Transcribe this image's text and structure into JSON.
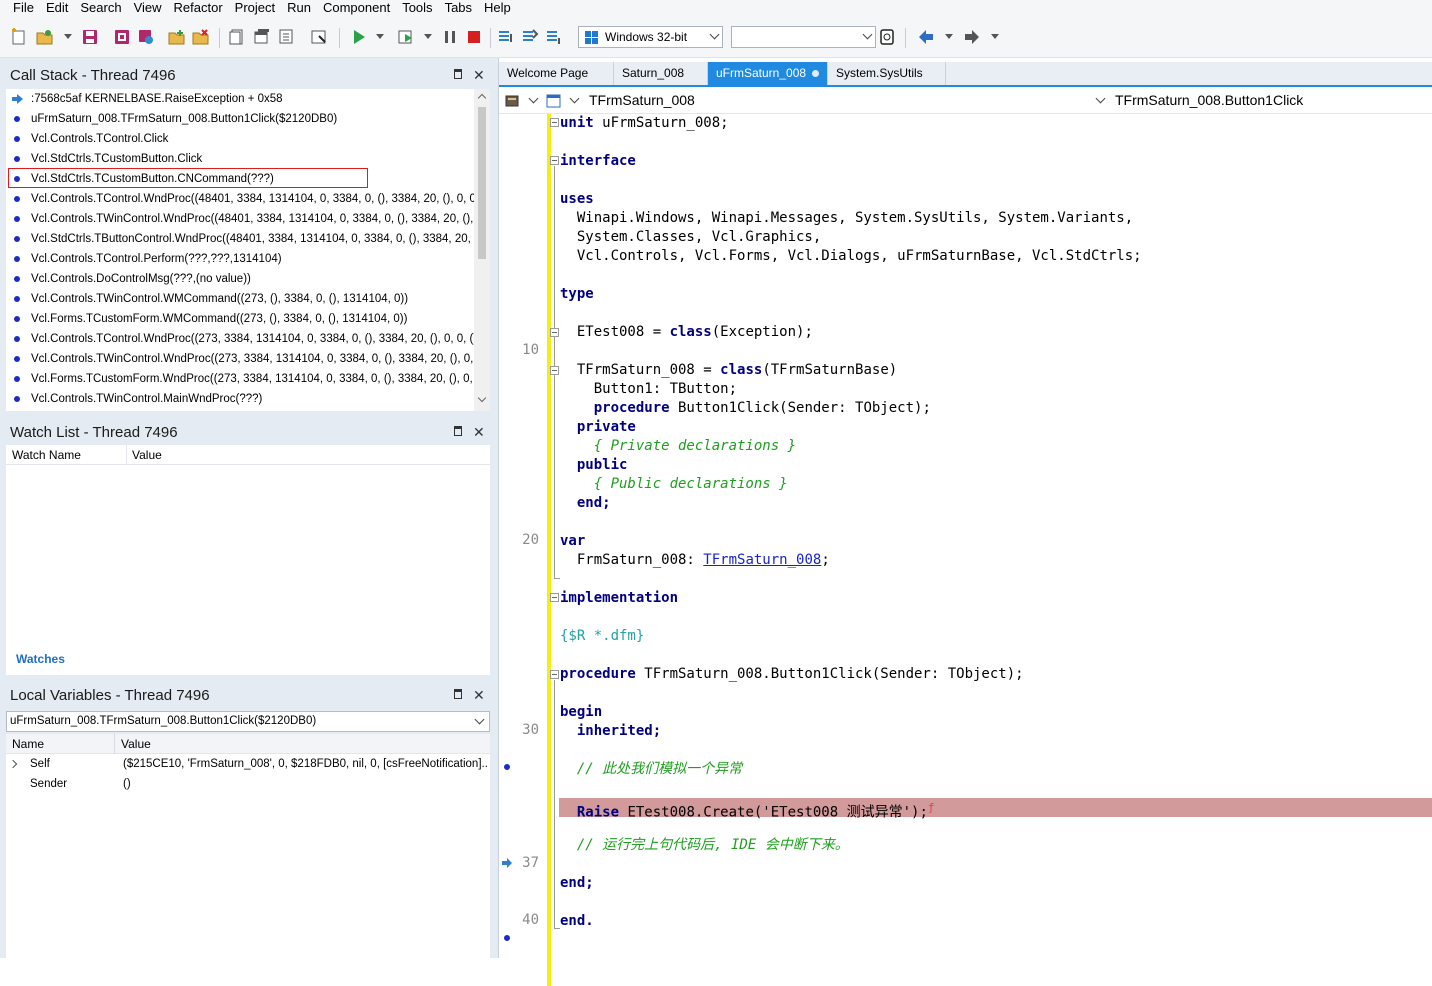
{
  "menu": [
    "File",
    "Edit",
    "Search",
    "View",
    "Refactor",
    "Project",
    "Run",
    "Component",
    "Tools",
    "Tabs",
    "Help"
  ],
  "toolbar": {
    "platform": "Windows 32-bit",
    "config": ""
  },
  "call_stack": {
    "title": "Call Stack - Thread 7496",
    "rows": [
      ":7568c5af KERNELBASE.RaiseException + 0x58",
      "uFrmSaturn_008.TFrmSaturn_008.Button1Click($2120DB0)",
      "Vcl.Controls.TControl.Click",
      "Vcl.StdCtrls.TCustomButton.Click",
      "Vcl.StdCtrls.TCustomButton.CNCommand(???)",
      "Vcl.Controls.TControl.WndProc((48401, 3384, 1314104, 0, 3384, 0, (), 3384, 20, (), 0, 0,",
      "Vcl.Controls.TWinControl.WndProc((48401, 3384, 1314104, 0, 3384, 0, (), 3384, 20, (),",
      "Vcl.StdCtrls.TButtonControl.WndProc((48401, 3384, 1314104, 0, 3384, 0, (), 3384, 20, (",
      "Vcl.Controls.TControl.Perform(???,???,1314104)",
      "Vcl.Controls.DoControlMsg(???,(no value))",
      "Vcl.Controls.TWinControl.WMCommand((273, (), 3384, 0, (), 1314104, 0))",
      "Vcl.Forms.TCustomForm.WMCommand((273, (), 3384, 0, (), 1314104, 0))",
      "Vcl.Controls.TControl.WndProc((273, 3384, 1314104, 0, 3384, 0, (), 3384, 20, (), 0, 0, ()",
      "Vcl.Controls.TWinControl.WndProc((273, 3384, 1314104, 0, 3384, 0, (), 3384, 20, (), 0,",
      "Vcl.Forms.TCustomForm.WndProc((273, 3384, 1314104, 0, 3384, 0, (), 3384, 20, (), 0, 0, (",
      "Vcl.Controls.TWinControl.MainWndProc(???)"
    ]
  },
  "watch_list": {
    "title": "Watch List - Thread 7496",
    "col_name": "Watch Name",
    "col_value": "Value",
    "tab": "Watches"
  },
  "local_vars": {
    "title": "Local Variables - Thread 7496",
    "frame": "uFrmSaturn_008.TFrmSaturn_008.Button1Click($2120DB0)",
    "col_name": "Name",
    "col_value": "Value",
    "rows": [
      {
        "name": "Self",
        "value": "($215CE10, 'FrmSaturn_008', 0, $218FDB0, nil, 0, [csFreeNotification]..."
      },
      {
        "name": "Sender",
        "value": "()"
      }
    ]
  },
  "tabs": [
    "Welcome Page",
    "Saturn_008",
    "uFrmSaturn_008",
    "System.SysUtils"
  ],
  "navbar": {
    "unit": "TFrmSaturn_008",
    "method": "TFrmSaturn_008.Button1Click"
  },
  "line_numbers": [
    "10",
    "20",
    "30",
    "37",
    "40"
  ],
  "code": {
    "l1_kw": "unit",
    "l1_rest": " uFrmSaturn_008;",
    "l3": "interface",
    "l5": "uses",
    "l6": "  Winapi.Windows, Winapi.Messages, System.SysUtils, System.Variants,",
    "l7": "  System.Classes, Vcl.Graphics,",
    "l8": "  Vcl.Controls, Vcl.Forms, Vcl.Dialogs, uFrmSaturnBase, Vcl.StdCtrls;",
    "l10": "type",
    "l12_a": "  ETest008 = ",
    "l12_kw": "class",
    "l12_b": "(Exception);",
    "l14_a": "  TFrmSaturn_008 = ",
    "l14_kw": "class",
    "l14_b": "(TFrmSaturnBase)",
    "l15": "    Button1: TButton;",
    "l16_kw": "    procedure",
    "l16_rest": " Button1Click(Sender: TObject);",
    "l17": "  private",
    "l18": "    { Private declarations }",
    "l19": "  public",
    "l20": "    { Public declarations }",
    "l21": "  end;",
    "l23": "var",
    "l24_a": "  FrmSaturn_008: ",
    "l24_link": "TFrmSaturn_008",
    "l24_b": ";",
    "l26": "implementation",
    "l28": "{$R *.dfm}",
    "l30_kw": "procedure",
    "l30_rest": " TFrmSaturn_008.Button1Click(Sender: TObject);",
    "l32": "begin",
    "l33": "  inherited;",
    "l35": "  // 此处我们模拟一个异常",
    "l37_kw": "  Raise",
    "l37_rest": " ETest008.Create('ETest008 测试异常');",
    "l39": "  // 运行完上句代码后, IDE 会中断下来。",
    "l41": "end;",
    "l43": "end."
  },
  "colors": {
    "accent": "#1f8ae0",
    "panel_bg": "#e4ebf2",
    "error_line": "#d29a9a",
    "gutter_bar": "#f3ef12"
  }
}
